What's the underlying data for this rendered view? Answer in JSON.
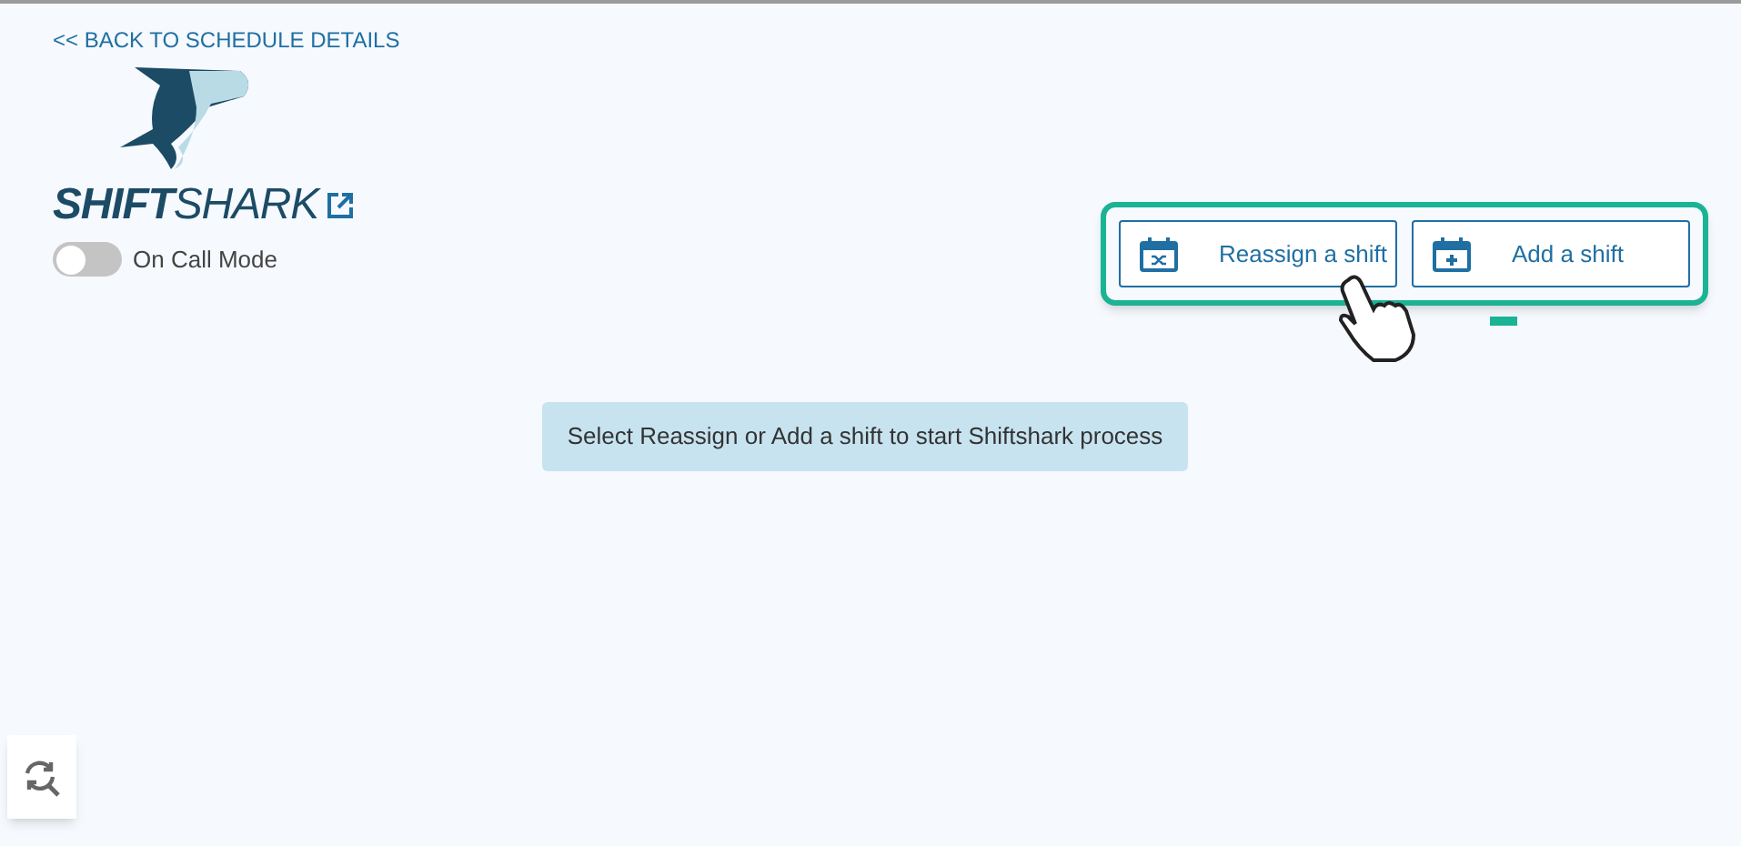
{
  "back_link": "<< BACK TO SCHEDULE DETAILS",
  "logo": {
    "text": "**SHIFT**SHARK"
  },
  "on_call_toggle": {
    "label": "On Call Mode",
    "on": false
  },
  "actions": [
    {
      "label": "Reassign a shift",
      "kind": "reassign"
    },
    {
      "label": "Add a shift",
      "kind": "add"
    }
  ],
  "message": "Select Reassign or Add a shift to start Shiftshark process"
}
